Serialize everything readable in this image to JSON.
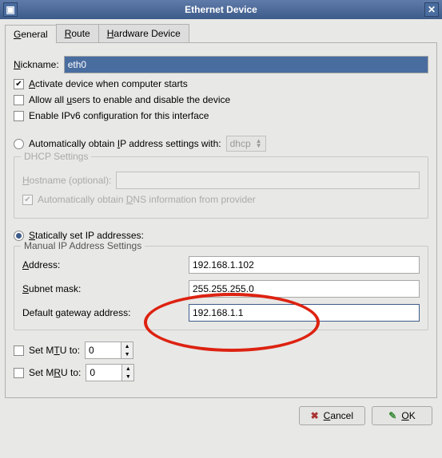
{
  "window": {
    "title": "Ethernet Device"
  },
  "tabs": [
    {
      "label": "General",
      "accel": "G",
      "active": true
    },
    {
      "label": "Route",
      "accel": "R",
      "active": false
    },
    {
      "label": "Hardware Device",
      "accel": "H",
      "active": false
    }
  ],
  "nickname": {
    "label": "Nickname:",
    "accel": "N",
    "value": "eth0"
  },
  "checkboxes": {
    "activate": {
      "label": "Activate device when computer starts",
      "accel": "A",
      "checked": true
    },
    "allusers": {
      "label": "Allow all users to enable and disable the device",
      "accel": "u",
      "checked": false
    },
    "ipv6": {
      "label": "Enable IPv6 configuration for this interface",
      "checked": false
    }
  },
  "radio_auto": {
    "label": "Automatically obtain IP address settings with:",
    "accel": "I",
    "checked": false
  },
  "dhcp_combo": {
    "value": "dhcp"
  },
  "dhcp_frame": {
    "title": "DHCP Settings",
    "hostname": {
      "label": "Hostname (optional):",
      "accel": "H",
      "value": ""
    },
    "auto_dns": {
      "label": "Automatically obtain DNS information from provider",
      "accel": "D",
      "checked": true
    }
  },
  "radio_static": {
    "label": "Statically set IP addresses:",
    "accel": "S",
    "checked": true
  },
  "manual_frame": {
    "title": "Manual IP Address Settings",
    "address": {
      "label": "Address:",
      "accel": "A",
      "value": "192.168.1.102"
    },
    "subnet": {
      "label": "Subnet mask:",
      "accel": "S",
      "value": "255.255.255.0"
    },
    "gateway": {
      "label": "Default gateway address:",
      "accel": "g",
      "value": "192.168.1.1"
    }
  },
  "mtu": {
    "label": "Set MTU to:",
    "accel": "T",
    "checked": false,
    "value": "0"
  },
  "mru": {
    "label": "Set MRU to:",
    "accel": "R",
    "checked": false,
    "value": "0"
  },
  "buttons": {
    "cancel": "Cancel",
    "ok": "OK"
  }
}
